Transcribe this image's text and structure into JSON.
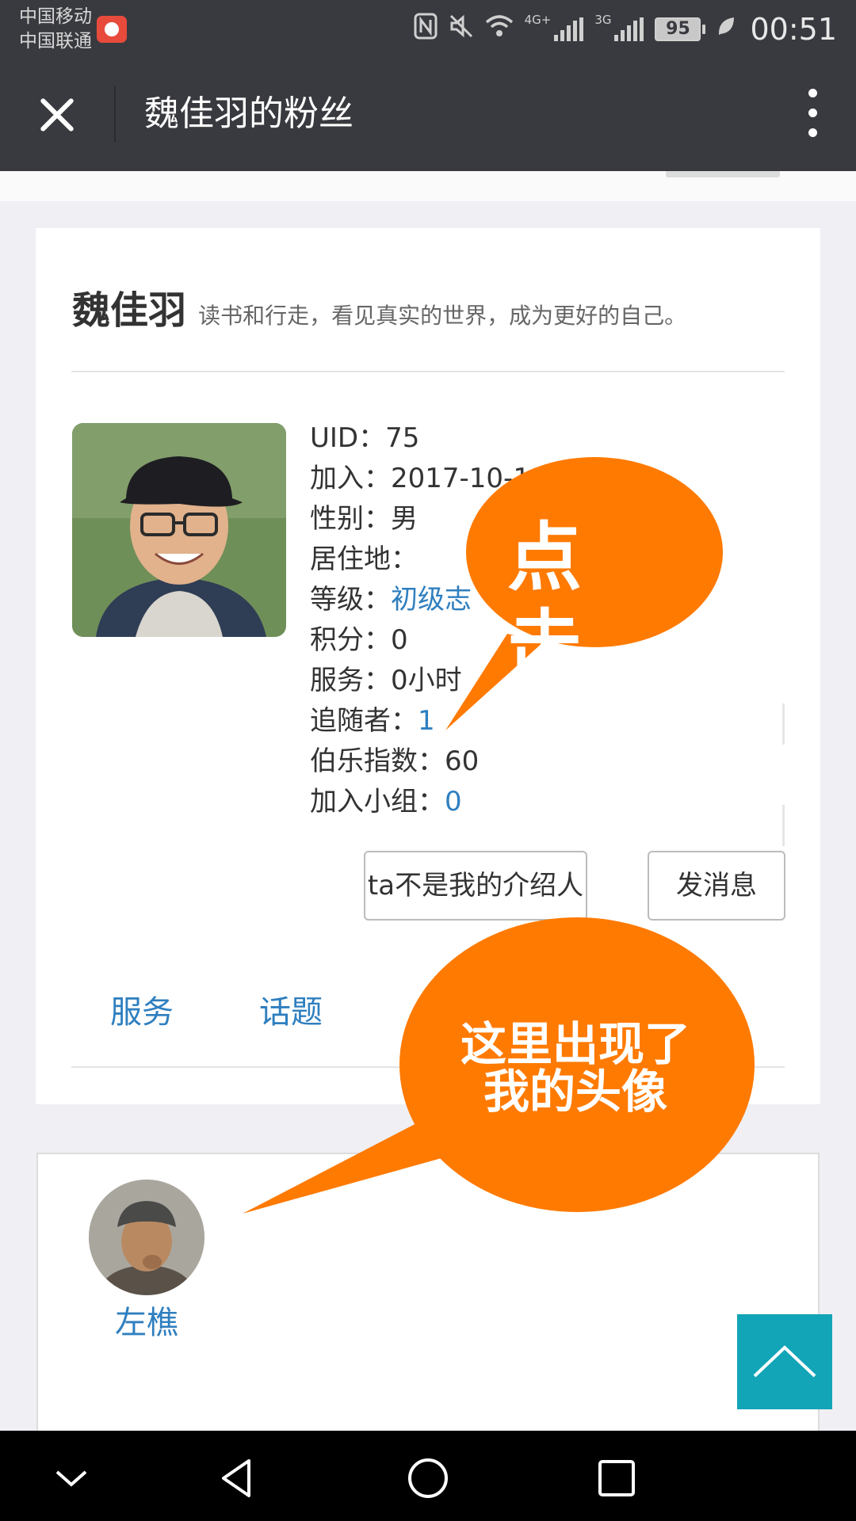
{
  "status_bar": {
    "carrier_1": "中国移动",
    "carrier_2": "中国联通",
    "network_1": "4G+",
    "network_2": "3G",
    "battery": "95",
    "time": "00:51"
  },
  "title_bar": {
    "title": "魏佳羽的粉丝",
    "icons": [
      "close-icon",
      "more-vertical-icon"
    ]
  },
  "profile": {
    "name": "魏佳羽",
    "motto": "读书和行走，看见真实的世界，成为更好的自己。",
    "uid": "UID：75",
    "joined": "加入：2017-10-1",
    "gender": "性别：男",
    "location": "居住地：",
    "level_label": "等级：",
    "level_value": "初级志",
    "points": "积分：0",
    "service": "服务：0小时",
    "followers_label": "追随者：",
    "followers_value": "1",
    "bole_index": "伯乐指数：60",
    "groups_label": "加入小组：",
    "groups_value": "0"
  },
  "actions": {
    "referrer_button": "ta不是我的介绍人",
    "message_button": "发消息"
  },
  "tabs": {
    "service": "服务",
    "topic": "话题"
  },
  "followers": [
    {
      "name": "左樵"
    }
  ],
  "annotations": {
    "click_callout": "点击",
    "avatar_callout_line1": "这里出现了",
    "avatar_callout_line2": "我的头像",
    "color": "#ff7a00"
  },
  "colors": {
    "header": "#393a3f",
    "link": "#2f7fbf",
    "scroll_top": "#12a4b7"
  }
}
